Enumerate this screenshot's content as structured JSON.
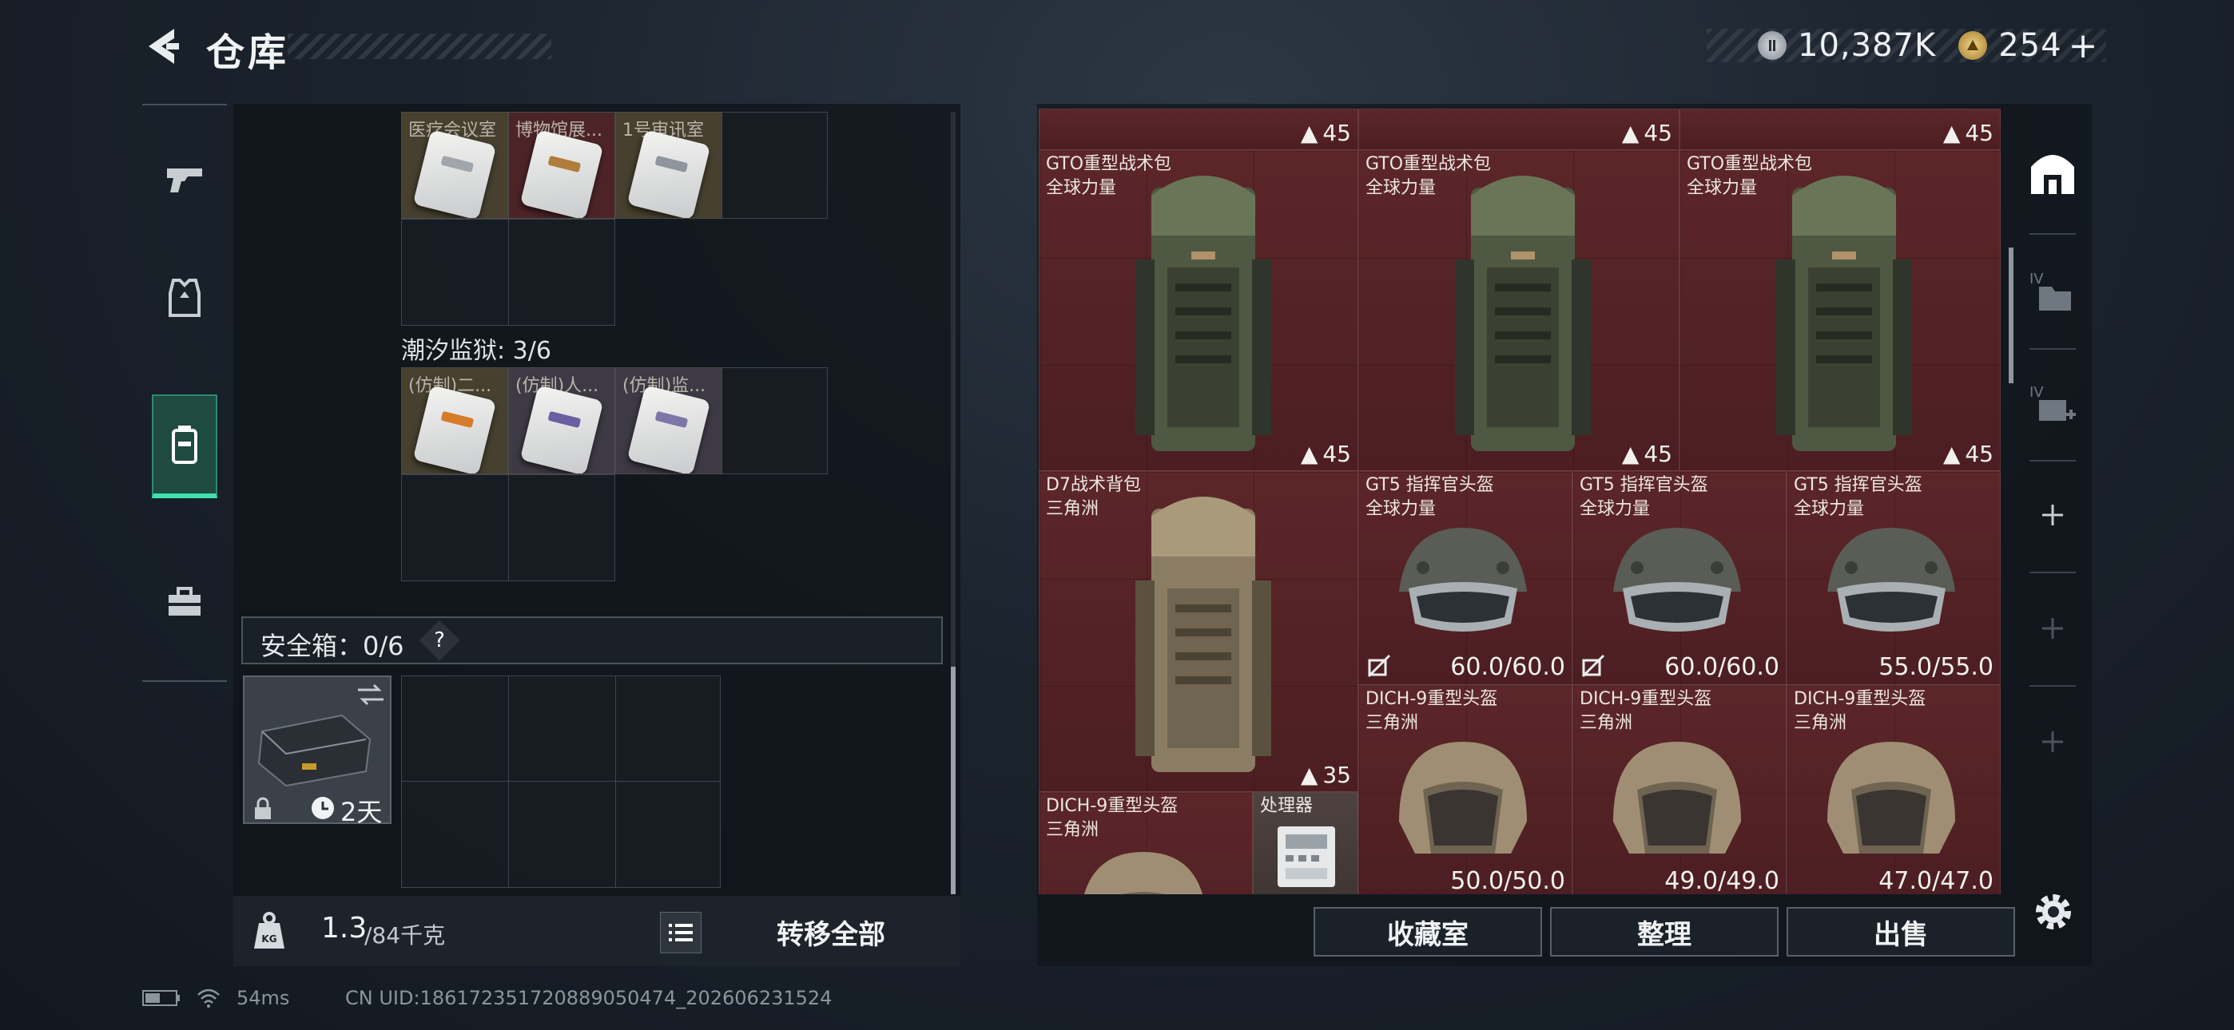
{
  "header": {
    "title": "仓库",
    "back_icon": "back-arrow-icon"
  },
  "currency": {
    "silver_value": "10,387K",
    "gold_value": "254",
    "plus_label": "+"
  },
  "left_nav": {
    "items": [
      {
        "icon": "pistol-icon"
      },
      {
        "icon": "armor-vest-icon"
      },
      {
        "icon": "backpack-icon",
        "active": true
      },
      {
        "icon": "toolbox-icon"
      }
    ]
  },
  "containers": {
    "top_cards": [
      "医疗会议室",
      "博物馆展...",
      "1号审讯室"
    ],
    "prison_label": "潮汐监狱: 3/6",
    "prison_cards": [
      "(仿制)二...",
      "(仿制)人...",
      "(仿制)监..."
    ]
  },
  "safe_box": {
    "label": "安全箱：0/6",
    "help": "?",
    "duration": "2天"
  },
  "weight": {
    "current": "1.3",
    "max": "/84千克"
  },
  "transfer_all": "转移全部",
  "stash": {
    "top_row_counts": [
      "45",
      "45",
      "45"
    ],
    "backpacks": [
      {
        "name": "GTO重型战术包",
        "faction": "全球力量",
        "count": "45"
      },
      {
        "name": "GTO重型战术包",
        "faction": "全球力量",
        "count": "45"
      },
      {
        "name": "GTO重型战术包",
        "faction": "全球力量",
        "count": "45"
      }
    ],
    "d7": {
      "name": "D7战术背包",
      "faction": "三角洲",
      "count": "35"
    },
    "gt5": [
      {
        "name": "GT5 指挥官头盔",
        "faction": "全球力量",
        "durability": "60.0/60.0"
      },
      {
        "name": "GT5 指挥官头盔",
        "faction": "全球力量",
        "durability": "60.0/60.0"
      },
      {
        "name": "GT5 指挥官头盔",
        "faction": "全球力量",
        "durability": "55.0/55.0"
      }
    ],
    "dich": [
      {
        "name": "DICH-9重型头盔",
        "faction": "三角洲",
        "durability": "50.0/50.0"
      },
      {
        "name": "DICH-9重型头盔",
        "faction": "三角洲",
        "durability": "49.0/49.0"
      },
      {
        "name": "DICH-9重型头盔",
        "faction": "三角洲",
        "durability": "47.0/47.0"
      }
    ],
    "dich_small": {
      "name": "DICH-9重型头盔",
      "faction": "三角洲"
    },
    "processor": {
      "name": "处理器"
    }
  },
  "right_tabs": [
    {
      "icon": "stash-home-icon",
      "active": true
    },
    {
      "icon": "folder-iv-icon"
    },
    {
      "icon": "expand-iv-icon"
    },
    {
      "icon": "plus-icon"
    },
    {
      "icon": "plus-icon"
    },
    {
      "icon": "plus-icon"
    }
  ],
  "bottom_buttons": {
    "collection": "收藏室",
    "organize": "整理",
    "sell": "出售"
  },
  "status": {
    "ping": "54ms",
    "uid": "CN UID:18617235172088905047​4_202606231524"
  },
  "colors": {
    "accent": "#3fe0b0",
    "stash_red": "#5a2427",
    "panel": "#12181f"
  }
}
